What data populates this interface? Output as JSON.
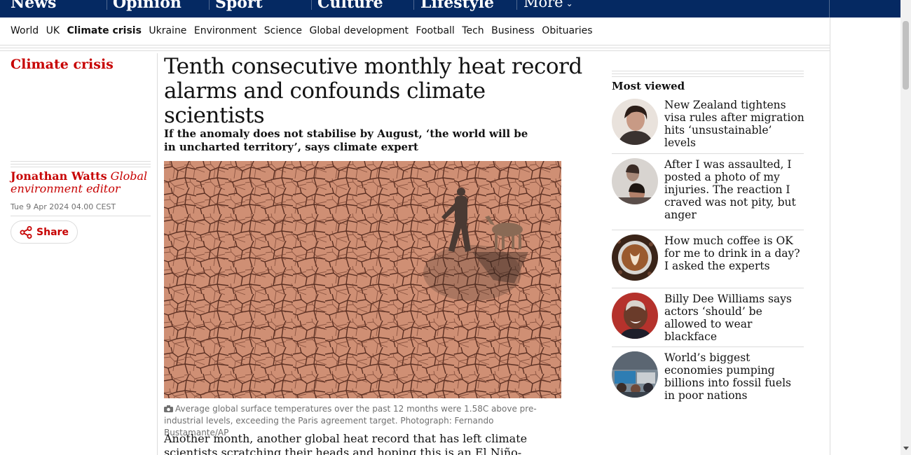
{
  "topnav": {
    "pillars": [
      "News",
      "Opinion",
      "Sport",
      "Culture",
      "Lifestyle"
    ],
    "more_label": "More",
    "background": "#052962"
  },
  "subnav": {
    "items": [
      "World",
      "UK",
      "Climate crisis",
      "Ukraine",
      "Environment",
      "Science",
      "Global development",
      "Football",
      "Tech",
      "Business",
      "Obituaries"
    ],
    "active": "Climate crisis"
  },
  "article": {
    "section": "Climate crisis",
    "headline": "Tenth consecutive monthly heat record alarms and confounds climate scientists",
    "standfirst": "If the anomaly does not stabilise by August, ‘the world will be in uncharted territory’, says climate expert",
    "author_name": "Jonathan Watts",
    "author_role": "Global environment editor",
    "date": "Tue 9 Apr 2024 04.00 CEST",
    "share_label": "Share",
    "caption": "Average global surface temperatures over the past 12 months were 1.58C above pre-industrial levels, exceeding the Paris agreement target. Photograph: Fernando Bustamante/AP",
    "body_start": "Another month, another global heat record that has left climate scientists scratching their heads and hoping this is an El Niño-related hangover rather",
    "accent_color": "#c70000"
  },
  "most_viewed": {
    "title": "Most viewed",
    "items": [
      {
        "title": "New Zealand tightens visa rules after migration hits ‘unsustainable’ levels"
      },
      {
        "title": "After I was assaulted, I posted a photo of my injuries. The reaction I craved was not pity, but anger"
      },
      {
        "title": "How much coffee is OK for me to drink in a day? I asked the experts"
      },
      {
        "title": "Billy Dee Williams says actors ‘should’ be allowed to wear blackface"
      },
      {
        "title": "World’s biggest economies pumping billions into fossil fuels in poor nations"
      }
    ]
  }
}
